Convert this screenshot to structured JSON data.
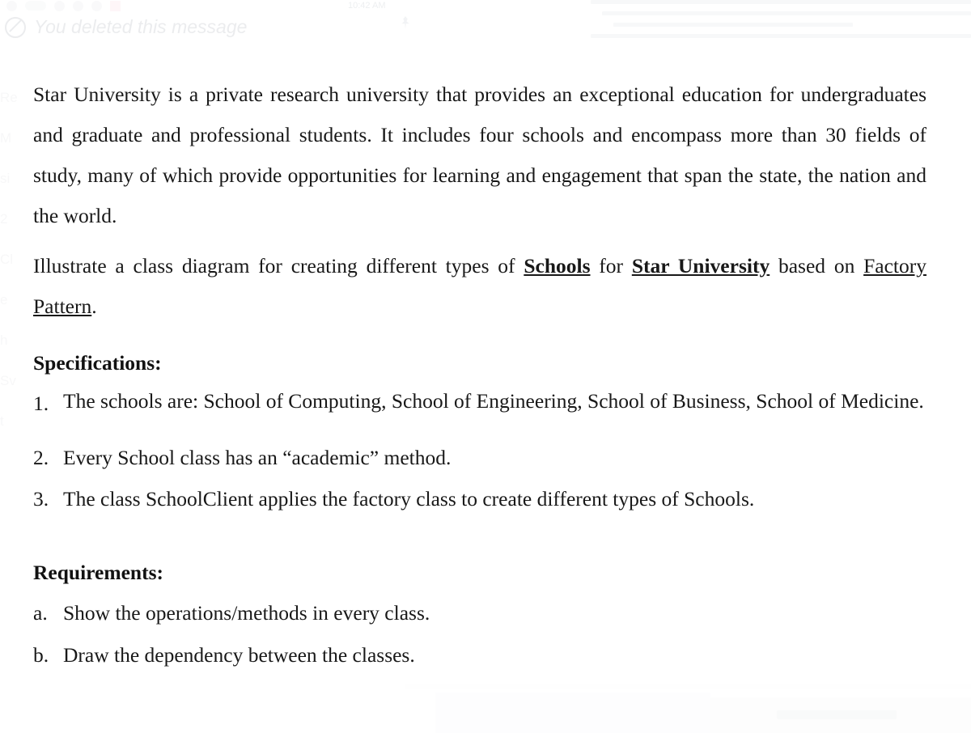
{
  "ghost": {
    "deleted_message": "You deleted this message",
    "timestamp": "10:42 AM",
    "sidebar_fragments": [
      "Re",
      "M",
      "si",
      "2",
      "Cl",
      "e",
      "h",
      "Sv",
      "t"
    ]
  },
  "document": {
    "paragraphs": {
      "intro": "Star University is a private research university that provides an exceptional education for undergraduates and graduate and professional students. It includes four schools and encompass more than 30 fields of study, many of which provide opportunities for learning and engagement that span the state, the nation and the world.",
      "illustrate": {
        "part1": "Illustrate a class diagram for creating different types of ",
        "emph1": "Schools",
        "part2": " for ",
        "emph2": "Star University",
        "part3": " based on ",
        "emph3": "Factory Pattern",
        "part4": "."
      }
    },
    "specifications": {
      "heading": "Specifications:",
      "items": [
        {
          "marker": "1.",
          "text": "The schools are: School of Computing, School of Engineering, School of Business, School of Medicine."
        },
        {
          "marker": "2.",
          "text": "Every School class has an “academic” method."
        },
        {
          "marker": "3.",
          "text": "The class SchoolClient applies the factory class to create different types of Schools."
        }
      ]
    },
    "requirements": {
      "heading": "Requirements:",
      "items": [
        {
          "marker": "a.",
          "text": "Show the operations/methods in every class."
        },
        {
          "marker": "b.",
          "text": "Draw the dependency between the classes."
        }
      ]
    }
  }
}
